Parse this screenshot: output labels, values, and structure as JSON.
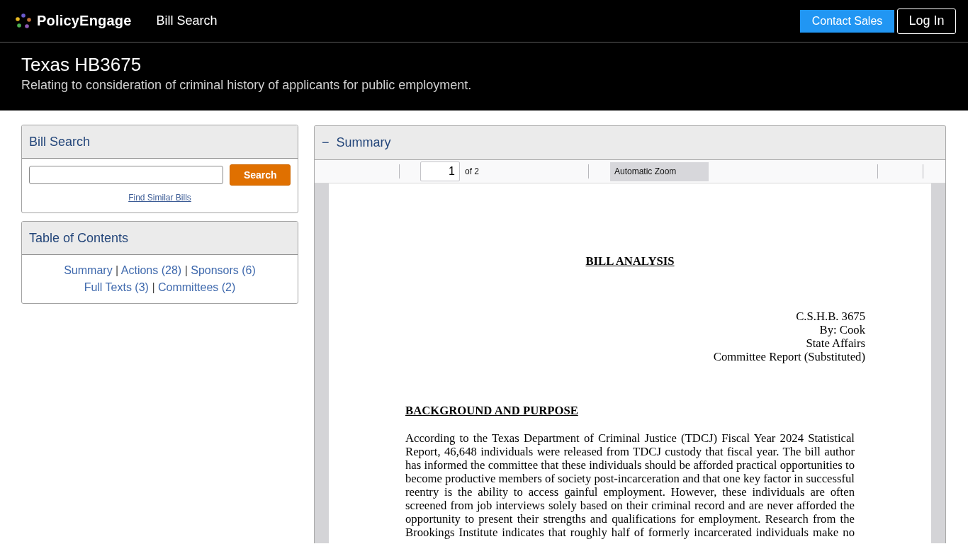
{
  "nav": {
    "brand": "PolicyEngage",
    "links": [
      "Bill Search"
    ],
    "buttons": [
      {
        "label": "Contact Sales",
        "kind": "primary"
      },
      {
        "label": "Log In",
        "kind": "outline"
      }
    ]
  },
  "header": {
    "title": "Texas HB3675",
    "subtitle": "Relating to consideration of criminal history of applicants for public employment."
  },
  "search_card": {
    "title": "Bill Search",
    "button": "Search",
    "link": "Find Similar Bills"
  },
  "toc_card": {
    "title": "Table of Contents",
    "lines": [
      [
        {
          "kind": "link",
          "text": "Summary"
        },
        {
          "kind": "separator",
          "text": "|"
        },
        {
          "kind": "link",
          "text": "Actions (28)"
        },
        {
          "kind": "separator",
          "text": "|"
        },
        {
          "kind": "link",
          "text": "Sponsors (6)"
        }
      ],
      [
        {
          "kind": "link",
          "text": "Full Texts (3)"
        },
        {
          "kind": "separator",
          "text": "|"
        },
        {
          "kind": "link",
          "text": "Committees (2)"
        }
      ]
    ]
  },
  "summary": {
    "toggle": "−",
    "title": "Summary",
    "toolbar": {
      "page": "1",
      "page_count": "of 2",
      "zoom": "Automatic Zoom"
    },
    "document": {
      "heading": "BILL ANALYSIS",
      "meta": [
        "C.S.H.B. 3675",
        "By: Cook",
        "State Affairs",
        "Committee Report (Substituted)"
      ],
      "sections": [
        {
          "heading": "BACKGROUND AND PURPOSE",
          "paragraph": "According to the Texas Department of Criminal Justice (TDCJ) Fiscal Year 2024 Statistical Report, 46,648 individuals were released from TDCJ custody that fiscal year. The bill author has informed the committee that these individuals should be afforded practical opportunities to become productive members of society post-incarceration and that one key factor in successful reentry is the ability to access gainful employment. However, these individuals are often screened from job interviews solely based on their criminal record and are never afforded the opportunity to present their strengths and qualifications for employment. Research from the Brookings Institute indicates that roughly half of formerly incarcerated individuals make no"
        }
      ]
    }
  }
}
